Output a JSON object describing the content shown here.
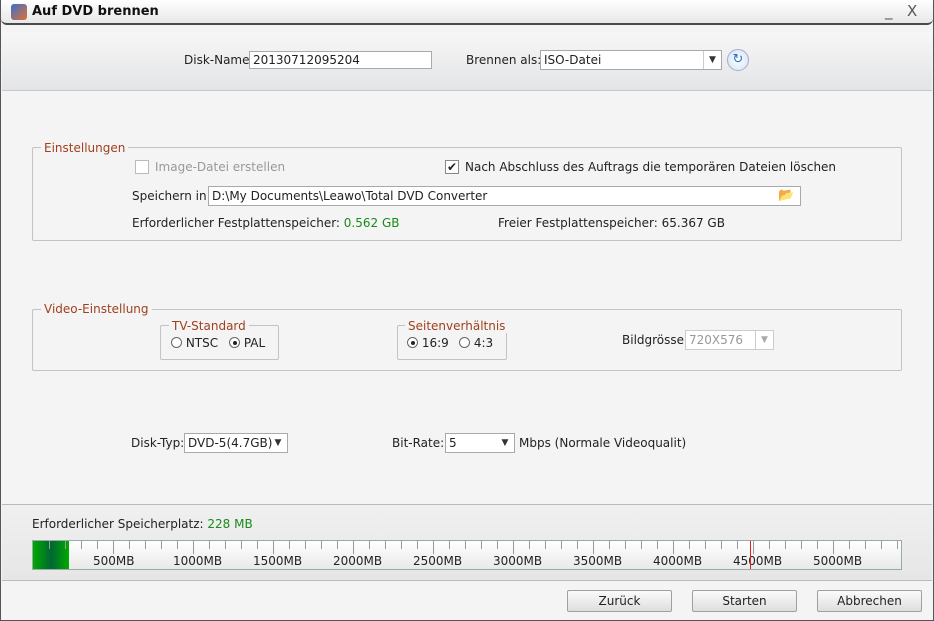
{
  "window": {
    "title": "Auf DVD brennen",
    "minimize": "_",
    "close": "X"
  },
  "top": {
    "disk_name_label": "Disk-Name:",
    "disk_name_value": "20130712095204",
    "burn_as_label": "Brennen als:",
    "burn_as_value": "ISO-Datei"
  },
  "settings": {
    "legend": "Einstellungen",
    "image_file_label": "Image-Datei erstellen",
    "image_file_checked": false,
    "delete_temp_label": "Nach Abschluss des Auftrags die temporären Dateien löschen",
    "delete_temp_checked": true,
    "save_in_label": "Speichern in:",
    "save_in_value": "D:\\My Documents\\Leawo\\Total DVD Converter",
    "required_label": "Erforderlicher Festplattenspeicher:",
    "required_value": "0.562 GB",
    "free_label": "Freier Festplattenspeicher:",
    "free_value": "65.367 GB"
  },
  "video": {
    "legend": "Video-Einstellung",
    "tv_legend": "TV-Standard",
    "ntsc": "NTSC",
    "pal": "PAL",
    "tv_selected": "PAL",
    "aspect_legend": "Seitenverhältnis",
    "r169": "16:9",
    "r43": "4:3",
    "aspect_selected": "16:9",
    "size_label": "Bildgrösse:",
    "size_value": "720X576"
  },
  "disk": {
    "type_label": "Disk-Typ:",
    "type_value": "DVD-5(4.7GB)",
    "bitrate_label": "Bit-Rate:",
    "bitrate_value": "5",
    "bitrate_unit": "Mbps (Normale Videoqualit)"
  },
  "storage": {
    "label": "Erforderlicher Speicherplatz:",
    "value": "228 MB",
    "used_mb": 228,
    "capacity_mark_mb": 4480,
    "max_mb": 5430,
    "ticks": [
      "500MB",
      "1000MB",
      "1500MB",
      "2000MB",
      "2500MB",
      "3000MB",
      "3500MB",
      "4000MB",
      "4500MB",
      "5000MB"
    ]
  },
  "buttons": {
    "back": "Zurück",
    "start": "Starten",
    "cancel": "Abbrechen"
  },
  "colors": {
    "accent_green": "#1a8a1a",
    "legend": "#a0401e",
    "mark": "#e02020"
  }
}
